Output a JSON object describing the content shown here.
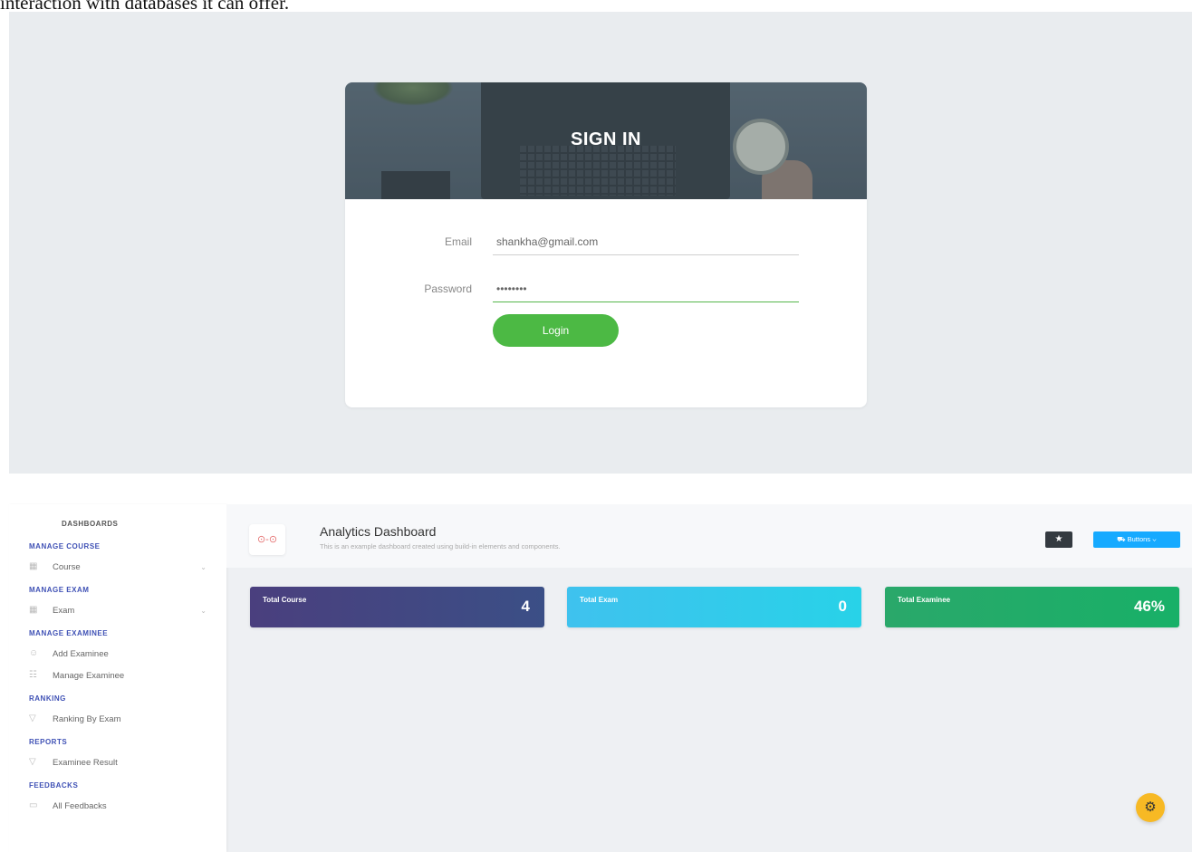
{
  "caption": "interaction with databases it can offer.",
  "signin": {
    "title": "SIGN IN",
    "email_label": "Email",
    "email_value": "shankha@gmail.com",
    "password_label": "Password",
    "password_value": "••••••••",
    "login_label": "Login",
    "accent_color": "#4cb944"
  },
  "dashboard": {
    "sidebar": {
      "sections": [
        {
          "heading": "DASHBOARDS",
          "items": []
        },
        {
          "heading": "MANAGE COURSE",
          "items": [
            {
              "label": "Course",
              "icon": "grid-icon",
              "expandable": true
            }
          ]
        },
        {
          "heading": "MANAGE EXAM",
          "items": [
            {
              "label": "Exam",
              "icon": "grid-icon",
              "expandable": true
            }
          ]
        },
        {
          "heading": "MANAGE EXAMINEE",
          "items": [
            {
              "label": "Add Examinee",
              "icon": "user-add-icon"
            },
            {
              "label": "Manage Examinee",
              "icon": "users-icon"
            }
          ]
        },
        {
          "heading": "RANKING",
          "items": [
            {
              "label": "Ranking By Exam",
              "icon": "trophy-icon"
            }
          ]
        },
        {
          "heading": "REPORTS",
          "items": [
            {
              "label": "Examinee Result",
              "icon": "trophy-icon"
            }
          ]
        },
        {
          "heading": "FEEDBACKS",
          "items": [
            {
              "label": "All Feedbacks",
              "icon": "chat-icon"
            }
          ]
        }
      ],
      "chevron": "⌄",
      "heading_color": "#3f51b5"
    },
    "header": {
      "icon": "⊙-⊙",
      "title": "Analytics Dashboard",
      "subtitle": "This is an example dashboard created using build-in elements and components.",
      "star_glyph": "★",
      "buttons_label": "⛟  Buttons  ⌄"
    },
    "stats": [
      {
        "label": "Total Course",
        "value": "4",
        "color": "#4a3f7e"
      },
      {
        "label": "Total Exam",
        "value": "0",
        "color": "#3fc2ee"
      },
      {
        "label": "Total Examinee",
        "value": "46%",
        "color": "#2aa86a"
      }
    ],
    "fab_glyph": "⚙"
  }
}
